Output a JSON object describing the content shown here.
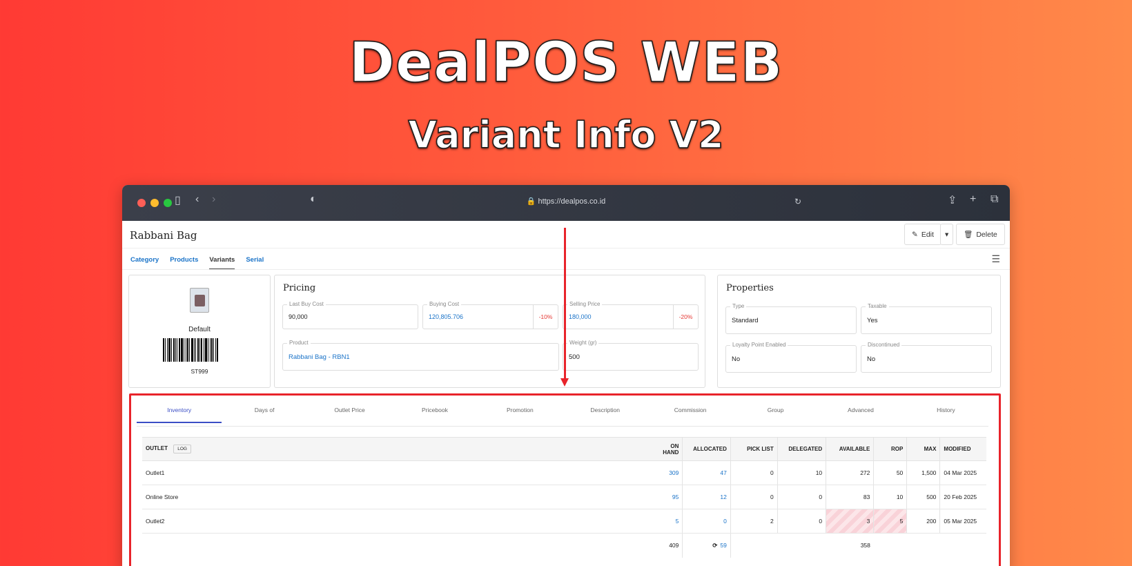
{
  "banner": {
    "title": "DealPOS WEB",
    "subtitle": "Variant Info V2"
  },
  "browser": {
    "url": "https://dealpos.co.id"
  },
  "page": {
    "title": "Rabbani Bag",
    "edit_label": "Edit",
    "delete_label": "Delete",
    "nav": [
      {
        "label": "Category",
        "active": false
      },
      {
        "label": "Products",
        "active": false
      },
      {
        "label": "Variants",
        "active": true
      },
      {
        "label": "Serial",
        "active": false
      }
    ]
  },
  "variant_card": {
    "name": "Default",
    "sku": "ST999"
  },
  "pricing": {
    "title": "Pricing",
    "last_buy_cost_label": "Last Buy Cost",
    "last_buy_cost": "90,000",
    "buying_cost_label": "Buying Cost",
    "buying_cost": "120,805.706",
    "buying_cost_badge": "-10%",
    "selling_price_label": "Selling Price",
    "selling_price": "180,000",
    "selling_price_badge": "-20%",
    "product_label": "Product",
    "product": "Rabbani Bag - RBN1",
    "weight_label": "Weight (gr)",
    "weight": "500"
  },
  "properties": {
    "title": "Properties",
    "type_label": "Type",
    "type": "Standard",
    "taxable_label": "Taxable",
    "taxable": "Yes",
    "loyalty_label": "Loyalty Point Enabled",
    "loyalty": "No",
    "discontinued_label": "Discontinued",
    "discontinued": "No"
  },
  "tabs": [
    "Inventory",
    "Days of",
    "Outlet Price",
    "Pricebook",
    "Promotion",
    "Description",
    "Commission",
    "Group",
    "Advanced",
    "History"
  ],
  "inventory": {
    "headers": {
      "outlet": "OUTLET",
      "log": "LOG",
      "on_hand": "ON HAND",
      "allocated": "ALLOCATED",
      "pick_list": "PICK LIST",
      "delegated": "DELEGATED",
      "available": "AVAILABLE",
      "rop": "ROP",
      "max": "MAX",
      "modified": "MODIFIED"
    },
    "rows": [
      {
        "outlet": "Outlet1",
        "on_hand": "309",
        "allocated": "47",
        "pick_list": "0",
        "delegated": "10",
        "available": "272",
        "rop": "50",
        "max": "1,500",
        "modified": "04 Mar 2025"
      },
      {
        "outlet": "Online Store",
        "on_hand": "95",
        "allocated": "12",
        "pick_list": "0",
        "delegated": "0",
        "available": "83",
        "rop": "10",
        "max": "500",
        "modified": "20 Feb 2025"
      },
      {
        "outlet": "Outlet2",
        "on_hand": "5",
        "allocated": "0",
        "pick_list": "2",
        "delegated": "0",
        "available": "3",
        "rop": "5",
        "max": "200",
        "modified": "05 Mar 2025"
      }
    ],
    "totals": {
      "on_hand": "409",
      "allocated": "59",
      "available": "358"
    }
  },
  "colors": {
    "accent": "#e8232a",
    "link": "#1a73c8",
    "negative": "#e53935",
    "tab_active": "#3b4ec5"
  }
}
